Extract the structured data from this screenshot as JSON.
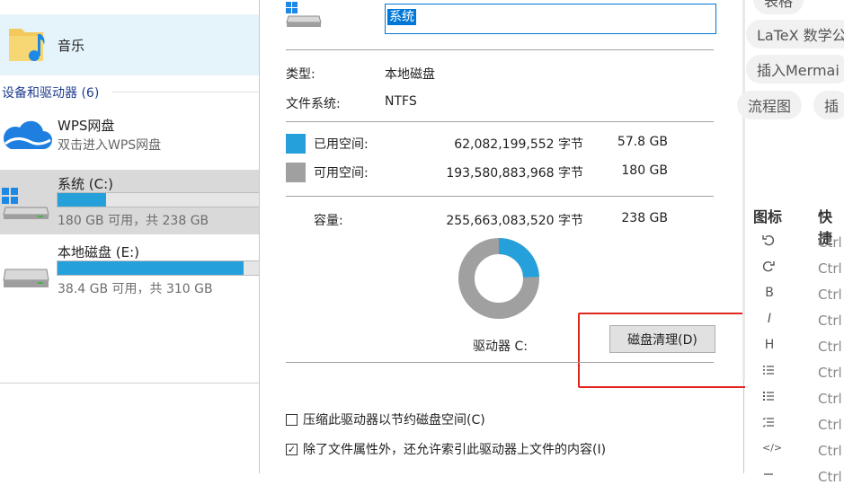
{
  "explorer": {
    "music_label": "音乐",
    "group_header": "设备和驱动器 (6)",
    "wps": {
      "title": "WPS网盘",
      "subtitle": "双击进入WPS网盘"
    },
    "drives": [
      {
        "name": "系统 (C:)",
        "usage_fraction": 0.24,
        "info": "180 GB 可用，共 238 GB",
        "selected": true
      },
      {
        "name": "本地磁盘 (E:)",
        "usage_fraction": 0.92,
        "info": "38.4 GB 可用，共 310 GB",
        "selected": false
      }
    ]
  },
  "dialog": {
    "name_value": "系统",
    "type_label": "类型:",
    "type_value": "本地磁盘",
    "fs_label": "文件系统:",
    "fs_value": "NTFS",
    "used": {
      "label": "已用空间:",
      "bytes": "62,082,199,552 字节",
      "gb": "57.8 GB",
      "color": "#26a0da"
    },
    "free": {
      "label": "可用空间:",
      "bytes": "193,580,883,968 字节",
      "gb": "180 GB",
      "color": "#a0a0a0"
    },
    "capacity": {
      "label": "容量:",
      "bytes": "255,663,083,520 字节",
      "gb": "238 GB"
    },
    "used_fraction": 0.243,
    "drive_caption": "驱动器 C:",
    "cleanup_button": "磁盘清理(D)",
    "compress_checkbox": {
      "label": "压缩此驱动器以节约磁盘空间(C)",
      "checked": false
    },
    "index_checkbox": {
      "label": "除了文件属性外，还允许索引此驱动器上文件的内容(I)",
      "checked": true
    },
    "highlight_color": "#e0271f"
  },
  "right_panel": {
    "chips": [
      "表格",
      "LaTeX 数学公",
      "插入Mermai",
      "流程图",
      "插"
    ],
    "col_icon_header": "图标",
    "col_shortcut_header": "快捷",
    "tools": [
      {
        "icon": "undo-icon",
        "shortcut": "Ctrl"
      },
      {
        "icon": "redo-icon",
        "shortcut": "Ctrl"
      },
      {
        "icon": "bold-icon",
        "glyph": "B",
        "shortcut": "Ctrl"
      },
      {
        "icon": "italic-icon",
        "glyph": "I",
        "shortcut": "Ctrl"
      },
      {
        "icon": "heading-icon",
        "glyph": "H",
        "shortcut": "Ctrl"
      },
      {
        "icon": "ordered-list-icon",
        "shortcut": "Ctrl"
      },
      {
        "icon": "unordered-list-icon",
        "shortcut": "Ctrl"
      },
      {
        "icon": "task-list-icon",
        "shortcut": "Ctrl"
      },
      {
        "icon": "code-icon",
        "glyph": "</>",
        "shortcut": "Ctrl"
      },
      {
        "icon": "more-icon",
        "shortcut": "Ctrl"
      }
    ]
  }
}
